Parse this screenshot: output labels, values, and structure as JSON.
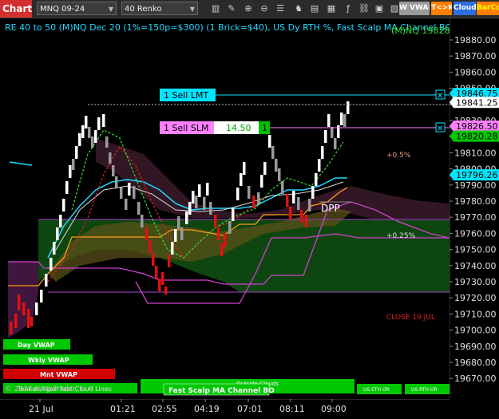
{
  "toolbar": {
    "chart_tab": "Chart",
    "instrument": "MNQ 09-24",
    "bar_type": "40 Renko",
    "vwap_btn": "W VWAP",
    "tk_btn": "T<>K",
    "cloud_btn": "Cloud",
    "barco_btn": "BarCo",
    "icons": [
      "bar-style-icon",
      "draw-icon",
      "zoom-in-icon",
      "zoom-out-icon",
      "properties-icon",
      "strategy-icon",
      "templates-icon",
      "news-icon",
      "indicators-icon",
      "attach-icon",
      "lock-icon",
      "help-icon"
    ]
  },
  "header": {
    "title": "RE 40 to 50 (M)NQ Dec 20 (1%=150p=$300) (1 Brick=$40), US Dy RTH %, Fast Scalp MA Channel BO",
    "top_right_value": "19828.25",
    "top_right_prefix": "(M)NQ"
  },
  "price_axis": {
    "ticks": [
      "19880.00",
      "19870.00",
      "19860.00",
      "19850.00",
      "19840.00",
      "19830.00",
      "19820.00",
      "19810.00",
      "19800.00",
      "19790.00",
      "19780.00",
      "19770.00",
      "19760.00",
      "19750.00",
      "19740.00",
      "19730.00",
      "19720.00",
      "19710.00",
      "19700.00",
      "19690.00",
      "19680.00",
      "19670.00"
    ],
    "flags": [
      {
        "value": "19846.75",
        "bg": "#00e5ff",
        "fg": "#000"
      },
      {
        "value": "19841.25",
        "bg": "#ffffff",
        "fg": "#000"
      },
      {
        "value": "19826.50",
        "bg": "#ff80ff",
        "fg": "#000"
      },
      {
        "value": "19820.28",
        "bg": "#00c800",
        "fg": "#000"
      },
      {
        "value": "19796.26",
        "bg": "#00e5ff",
        "fg": "#000"
      }
    ]
  },
  "time_axis": {
    "labels": [
      "21 Jul",
      "01:21",
      "02:55",
      "04:19",
      "07:01",
      "08:11",
      "09:00"
    ]
  },
  "orders": {
    "sell_lmt": {
      "label": "1 Sell LMT"
    },
    "sell_slm": {
      "label": "1 Sell SLM",
      "price": "14.50",
      "qty": "1"
    }
  },
  "annotations": {
    "pct_05": "+0.5%",
    "pct_025": "+0.25%",
    "dpp": "DPP",
    "close": "CLOSE 19 JUL"
  },
  "bottom_legend": {
    "day_vwap": "Day VWAP",
    "wkly_vwap": "Wkly VWAP",
    "mnt_vwap": "Mnt VWAP",
    "copyright": "© 2024 NinjaTrader, LLC",
    "tenkan": "Tenkan/Kijun Fast Cloud Lines",
    "outside_clouds": "Outside Clouds",
    "fast_scalp": "Fast Scalp MA Channel BO",
    "us_eth_or": "US ETH OR",
    "us_rth_or": "US RTH OR"
  },
  "colors": {
    "background": "#000000",
    "up_brick": "#ffffff",
    "down_brick": "#e01010",
    "neutral_brick": "#9a9a9a",
    "ma_cyan": "#22d8ff",
    "orange": "#ff9a1a",
    "magenta": "#d040d0",
    "green_fill": "#0e4a10"
  }
}
